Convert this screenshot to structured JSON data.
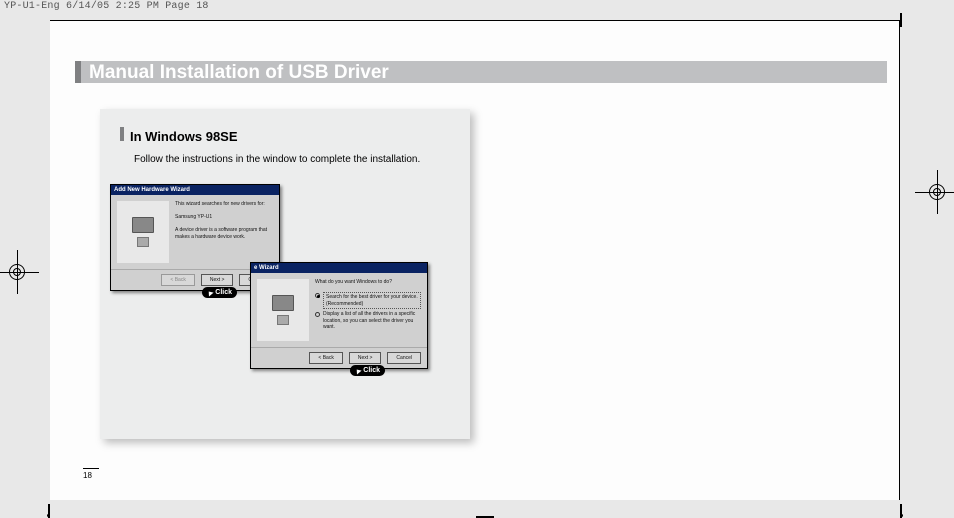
{
  "header": "YP-U1-Eng  6/14/05 2:25 PM  Page 18",
  "page_title": "Manual Installation of USB Driver",
  "section": {
    "title": "In Windows 98SE",
    "text": "Follow the instructions in the window to complete the installation."
  },
  "wizard1": {
    "titlebar": "Add New Hardware Wizard",
    "lead": "This wizard searches for new drivers for:",
    "device": "Samsung YP-U1",
    "desc": "A device driver is a software program that makes a hardware device work.",
    "back": "< Back",
    "next": "Next >",
    "cancel": "Cancel",
    "click": "Click"
  },
  "wizard2": {
    "titlebar": "e Wizard",
    "question": "What do you want Windows to do?",
    "opt1": "Search for the best driver for your device. (Recommended)",
    "opt2": "Display a list of all the drivers in a specific location, so you can select the driver you want.",
    "back": "< Back",
    "next": "Next >",
    "cancel": "Cancel",
    "click": "Click"
  },
  "page_number": "18"
}
